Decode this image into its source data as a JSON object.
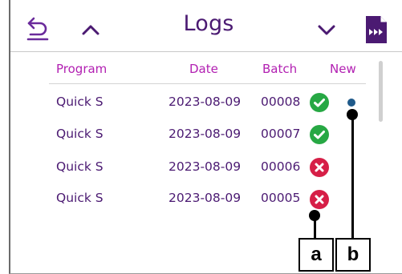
{
  "header": {
    "title": "Logs"
  },
  "table": {
    "columns": {
      "program": "Program",
      "date": "Date",
      "batch": "Batch",
      "new": "New"
    },
    "rows": [
      {
        "program": "Quick S",
        "date": "2023-08-09",
        "batch": "00008",
        "status": "success",
        "new": true
      },
      {
        "program": "Quick S",
        "date": "2023-08-09",
        "batch": "00007",
        "status": "success",
        "new": false
      },
      {
        "program": "Quick S",
        "date": "2023-08-09",
        "batch": "00006",
        "status": "failed",
        "new": false
      },
      {
        "program": "Quick S",
        "date": "2023-08-09",
        "batch": "00005",
        "status": "failed",
        "new": false
      }
    ]
  },
  "icons": {
    "back": "back-arrow-icon",
    "up": "chevron-up-icon",
    "down": "chevron-down-icon",
    "export": "export-file-icon",
    "success": "check-circle-icon",
    "failed": "x-circle-icon",
    "new": "new-indicator-dot"
  },
  "colors": {
    "brand": "#4b1a72",
    "header_text": "#b220b2",
    "success": "#27a844",
    "failed": "#d61f47",
    "new_dot": "#1f5a8a"
  },
  "callouts": {
    "a": "a",
    "b": "b"
  }
}
